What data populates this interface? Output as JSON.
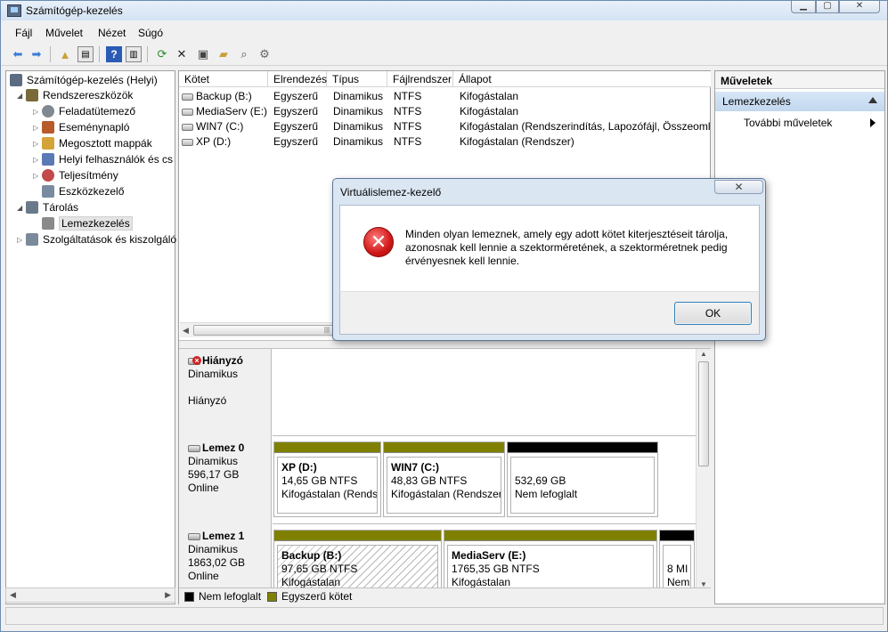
{
  "window": {
    "title": "Számítógép-kezelés"
  },
  "menu": [
    "Fájl",
    "Művelet",
    "Nézet",
    "Súgó"
  ],
  "toolbar_icons": [
    "back-arrow-icon",
    "forward-arrow-icon",
    "up-folder-icon",
    "show-hide-tree-icon",
    "help-icon",
    "show-hide-action-pane-icon",
    "refresh-icon",
    "delete-icon",
    "properties-icon",
    "open-folder-icon",
    "search-icon",
    "settings-icon"
  ],
  "tree": {
    "root": "Számítógép-kezelés (Helyi)",
    "items": [
      {
        "label": "Rendszereszközök",
        "icon": "tools-icon",
        "color": "#7a6a3a"
      },
      {
        "label": "Feladatütemező",
        "icon": "clock-icon",
        "color": "#808890"
      },
      {
        "label": "Eseménynapló",
        "icon": "event-log-icon",
        "color": "#b85a2a"
      },
      {
        "label": "Megosztott mappák",
        "icon": "shared-folder-icon",
        "color": "#d4a43a"
      },
      {
        "label": "Helyi felhasználók és cs",
        "icon": "users-icon",
        "color": "#5a7ab5"
      },
      {
        "label": "Teljesítmény",
        "icon": "performance-icon",
        "color": "#c24a4a"
      },
      {
        "label": "Eszközkezelő",
        "icon": "device-manager-icon",
        "color": "#7a8aa0"
      },
      {
        "label": "Tárolás",
        "icon": "storage-icon",
        "color": "#6a7a8a"
      },
      {
        "label": "Lemezkezelés",
        "icon": "disk-management-icon",
        "color": "#8a8a8a"
      },
      {
        "label": "Szolgáltatások és kiszolgáló",
        "icon": "services-icon",
        "color": "#7a8a9a"
      }
    ]
  },
  "volumes": {
    "columns": [
      "Kötet",
      "Elrendezés",
      "Típus",
      "Fájlrendszer",
      "Állapot"
    ],
    "rows": [
      [
        "Backup (B:)",
        "Egyszerű",
        "Dinamikus",
        "NTFS",
        "Kifogástalan"
      ],
      [
        "MediaServ (E:)",
        "Egyszerű",
        "Dinamikus",
        "NTFS",
        "Kifogástalan"
      ],
      [
        "WIN7 (C:)",
        "Egyszerű",
        "Dinamikus",
        "NTFS",
        "Kifogástalan (Rendszerindítás, Lapozófájl, Összeomlás"
      ],
      [
        "XP (D:)",
        "Egyszerű",
        "Dinamikus",
        "NTFS",
        "Kifogástalan (Rendszer)"
      ]
    ]
  },
  "disks": [
    {
      "name": "Hiányzó",
      "type": "Dinamikus",
      "size": "",
      "state": "Hiányzó",
      "partitions": []
    },
    {
      "name": "Lemez 0",
      "type": "Dinamikus",
      "size": "596,17 GB",
      "state": "Online",
      "partitions": [
        {
          "name": "XP  (D:)",
          "size": "14,65 GB NTFS",
          "status": "Kifogástalan (Rendsz",
          "bar_color": "#808000"
        },
        {
          "name": "WIN7  (C:)",
          "size": "48,83 GB NTFS",
          "status": "Kifogástalan (Rendszeri",
          "bar_color": "#808000"
        },
        {
          "name": "",
          "size": "532,69 GB",
          "status": "Nem lefoglalt",
          "bar_color": "#000000"
        }
      ]
    },
    {
      "name": "Lemez 1",
      "type": "Dinamikus",
      "size": "1863,02 GB",
      "state": "Online",
      "partitions": [
        {
          "name": "Backup  (B:)",
          "size": "97,65 GB NTFS",
          "status": "Kifogástalan",
          "bar_color": "#808000"
        },
        {
          "name": "MediaServ  (E:)",
          "size": "1765,35 GB NTFS",
          "status": "Kifogástalan",
          "bar_color": "#808000"
        },
        {
          "name": "",
          "size": "8 MI",
          "status": "Nem",
          "bar_color": "#000000"
        }
      ]
    }
  ],
  "legend": [
    {
      "label": "Nem lefoglalt",
      "color": "#000000"
    },
    {
      "label": "Egyszerű kötet",
      "color": "#808000"
    }
  ],
  "actions": {
    "header": "Műveletek",
    "section": "Lemezkezelés",
    "more": "További műveletek"
  },
  "dialog": {
    "title": "Virtuálislemez-kezelő",
    "message": "Minden olyan lemeznek, amely egy adott kötet kiterjesztéseit tárolja, azonosnak kell lennie a szektorméretének, a szektorméretnek pedig érvényesnek kell lennie.",
    "ok": "OK",
    "close": "✕"
  }
}
